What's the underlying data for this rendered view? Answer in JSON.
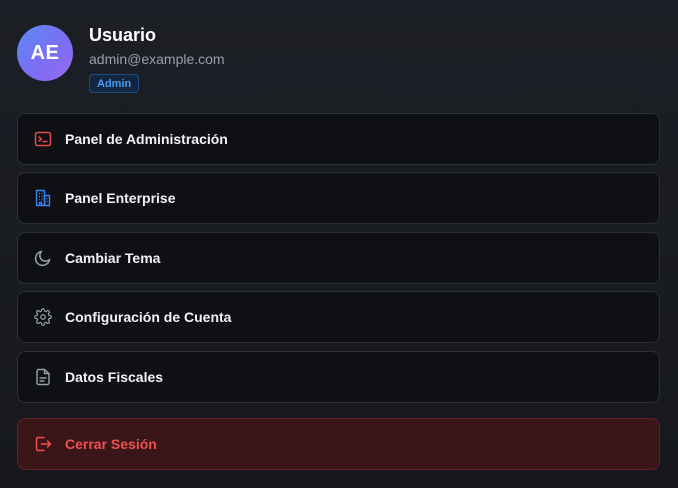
{
  "profile": {
    "initials": "AE",
    "name": "Usuario",
    "email": "admin@example.com",
    "role": "Admin"
  },
  "menu": [
    {
      "label": "Panel de Administración",
      "icon": "terminal-icon",
      "color": "#e5484d"
    },
    {
      "label": "Panel Enterprise",
      "icon": "building-icon",
      "color": "#3b82f6"
    },
    {
      "label": "Cambiar Tema",
      "icon": "moon-icon",
      "color": "#9aa1ad"
    },
    {
      "label": "Configuración de Cuenta",
      "icon": "gear-icon",
      "color": "#9aa1ad"
    },
    {
      "label": "Datos Fiscales",
      "icon": "document-icon",
      "color": "#9aa1ad"
    }
  ],
  "logout": {
    "label": "Cerrar Sesión",
    "icon": "logout-icon",
    "color": "#f0504f"
  },
  "colors": {
    "background": "#16181d",
    "item_background": "#0e1014",
    "item_border": "#2c3038",
    "badge_text": "#4a9bf5",
    "logout_background": "#3a1619"
  }
}
